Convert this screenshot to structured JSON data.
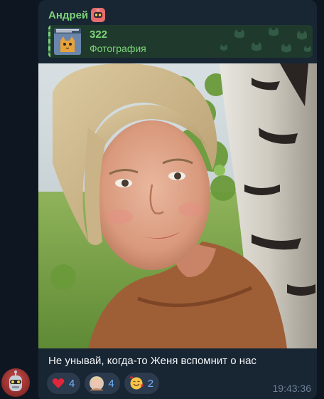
{
  "message": {
    "sender": {
      "name": "Андрей",
      "emoji_icon": "robot-emoji-icon"
    },
    "reply": {
      "title": "322",
      "subtitle": "Фотография",
      "thumb_icon": "cat-meme-thumbnail"
    },
    "caption": "Не унывай, когда-то Женя вспомнит о нас",
    "time": "19:43:36",
    "reactions": [
      {
        "icon": "red-heart-icon",
        "count": "4"
      },
      {
        "icon": "user-avatar-icon",
        "count": "4"
      },
      {
        "icon": "smiling-face-with-hearts-icon",
        "count": "2"
      }
    ]
  },
  "colors": {
    "background": "#0e1621",
    "bubble": "#182533",
    "sender": "#7ed37a",
    "reaction_count": "#6fb1ff",
    "time": "#6c7f94"
  }
}
